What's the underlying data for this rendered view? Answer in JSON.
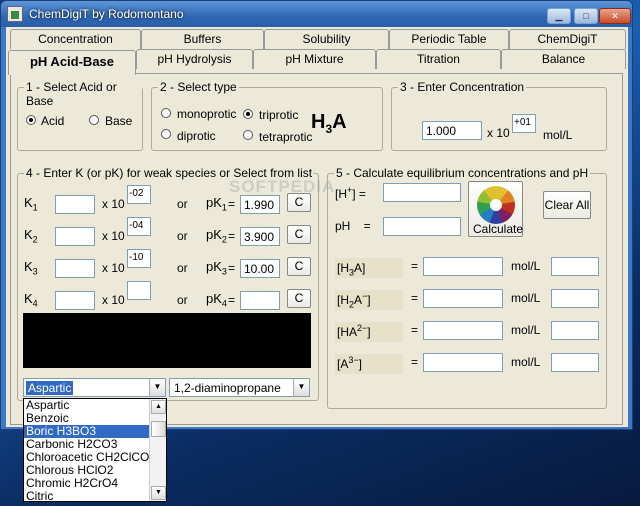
{
  "window": {
    "title": "ChemDigiT by Rodomontano",
    "minimize": "▁",
    "maximize": "□",
    "close": "✕"
  },
  "tabs_row1": [
    "Concentration",
    "Buffers",
    "Solubility",
    "Periodic Table",
    "ChemDigiT"
  ],
  "tabs_row2": [
    "pH Acid-Base",
    "pH Hydrolysis",
    "pH Mixture",
    "Titration",
    "Balance"
  ],
  "group1": {
    "title": "1 - Select Acid or Base",
    "acid": "Acid",
    "base": "Base"
  },
  "group2": {
    "title": "2 - Select type",
    "monoprotic": "monoprotic",
    "diprotic": "diprotic",
    "triprotic": "triprotic",
    "tetraprotic": "tetraprotic",
    "formula": "H",
    "formula_sub": "3",
    "formula_end": "A"
  },
  "group3": {
    "title": "3 - Enter Concentration",
    "value": "1.000",
    "x10": "x 10",
    "exponent": "+01",
    "unit": "mol/L"
  },
  "group4": {
    "title": "4 - Enter K (or pK) for weak species or Select from list",
    "rows": [
      {
        "k": "K",
        "ksub": "1",
        "x10": "x 10",
        "exp": "-02",
        "or": "or",
        "pk": "pK",
        "pksub": "1",
        "eq": "=",
        "pkval": "1.990",
        "c": "C"
      },
      {
        "k": "K",
        "ksub": "2",
        "x10": "x 10",
        "exp": "-04",
        "or": "or",
        "pk": "pK",
        "pksub": "2",
        "eq": "=",
        "pkval": "3.900",
        "c": "C"
      },
      {
        "k": "K",
        "ksub": "3",
        "x10": "x 10",
        "exp": "-10",
        "or": "or",
        "pk": "pK",
        "pksub": "3",
        "eq": "=",
        "pkval": "10.00",
        "c": "C"
      },
      {
        "k": "K",
        "ksub": "4",
        "x10": "x 10",
        "exp": "",
        "or": "or",
        "pk": "pK",
        "pksub": "4",
        "eq": "=",
        "pkval": "",
        "c": "C"
      }
    ],
    "combo1": "Aspartic",
    "combo2": "1,2-diaminopropane"
  },
  "group5": {
    "title": "5 - Calculate equilibrium concentrations and pH",
    "h_label": "[H",
    "h_sup": "+",
    "h_end": "] =",
    "ph_label": "pH    =",
    "calculate": "Calculate",
    "clear_all": "Clear All",
    "species": [
      {
        "pre": "[H",
        "sub": "3",
        "mid": "A",
        "sup": "",
        "end": "]",
        "eq": "=",
        "unit": "mol/L"
      },
      {
        "pre": "[H",
        "sub": "2",
        "mid": "A",
        "sup": "−",
        "end": "]",
        "eq": "=",
        "unit": "mol/L"
      },
      {
        "pre": "[HA",
        "sub": "",
        "mid": "",
        "sup": "2−",
        "end": "]",
        "eq": "=",
        "unit": "mol/L"
      },
      {
        "pre": "[A",
        "sub": "",
        "mid": "",
        "sup": "3−",
        "end": "]",
        "eq": "=",
        "unit": "mol/L"
      }
    ]
  },
  "dropdown_items": [
    "Aspartic",
    "Benzoic",
    "Boric H3BO3",
    "Carbonic H2CO3",
    "Chloroacetic CH2ClCOOH",
    "Chlorous HClO2",
    "Chromic H2CrO4",
    "Citric"
  ],
  "dropdown_selected": "Boric H3BO3",
  "watermark": "SOFTPEDIA"
}
